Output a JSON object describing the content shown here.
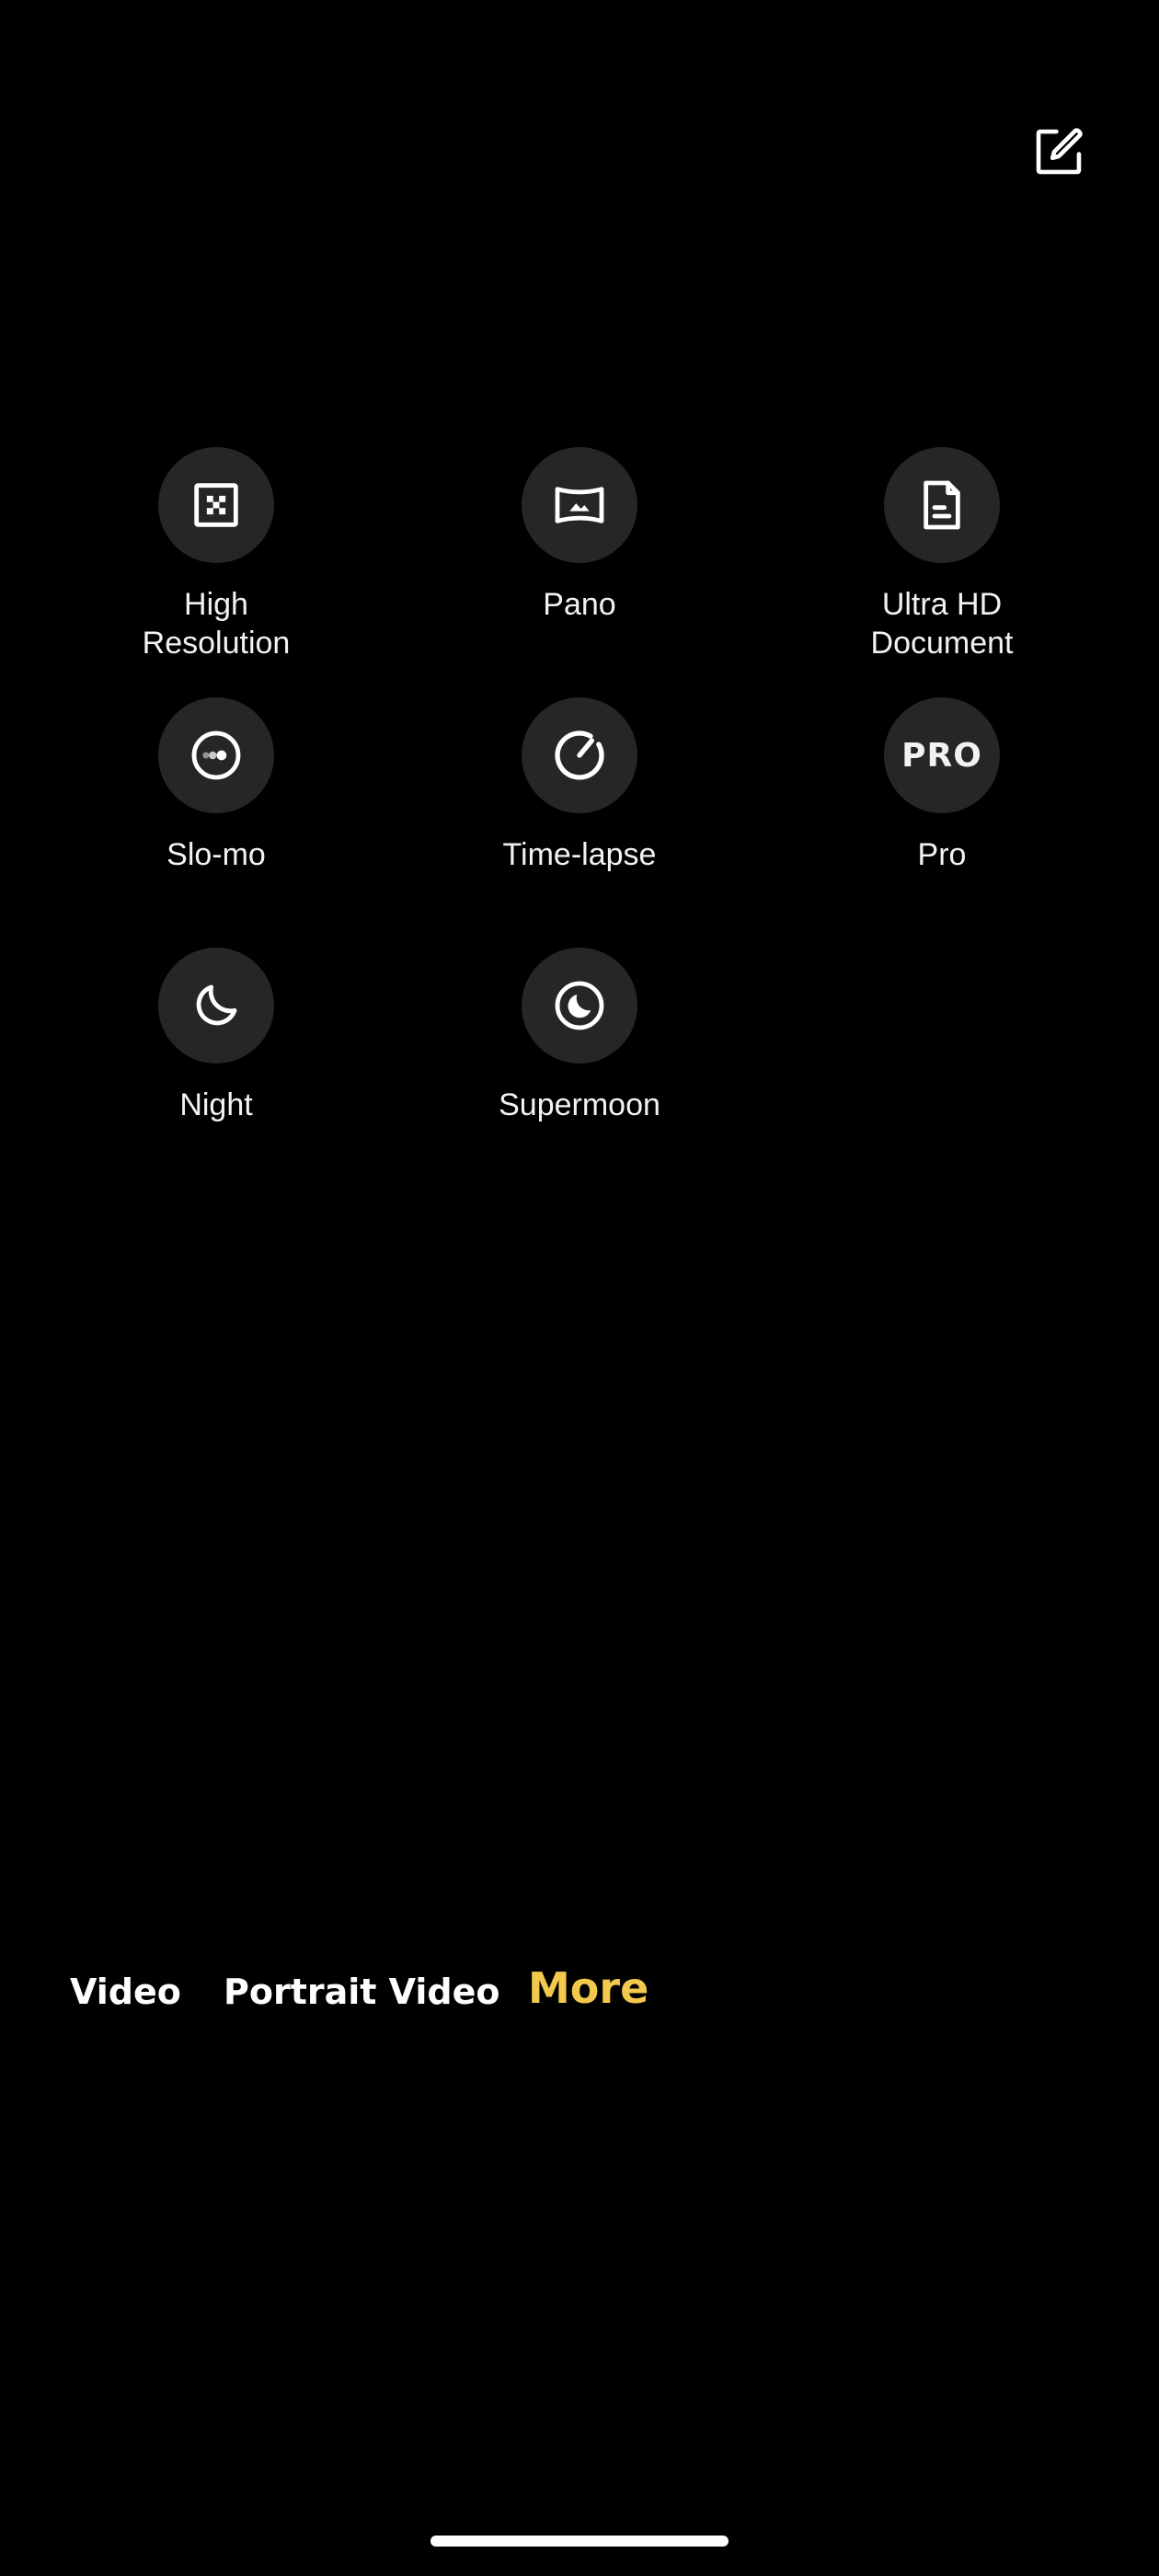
{
  "header": {
    "edit_icon": "edit-square-icon"
  },
  "modes": [
    {
      "label": "High\nResolution",
      "icon": "high-resolution-icon"
    },
    {
      "label": "Pano",
      "icon": "panorama-icon"
    },
    {
      "label": "Ultra HD\nDocument",
      "icon": "document-icon"
    },
    {
      "label": "Slo-mo",
      "icon": "slow-motion-icon"
    },
    {
      "label": "Time-lapse",
      "icon": "timelapse-icon"
    },
    {
      "label": "Pro",
      "icon_text": "PRO",
      "icon": "pro-icon"
    },
    {
      "label": "Night",
      "icon": "night-moon-icon"
    },
    {
      "label": "Supermoon",
      "icon": "supermoon-icon"
    }
  ],
  "tabs": [
    {
      "label": "Video",
      "active": false
    },
    {
      "label": "Portrait Video",
      "active": false
    },
    {
      "label": "More",
      "active": true
    }
  ],
  "colors": {
    "background": "#000000",
    "icon_circle": "#262626",
    "accent": "#F2C94C",
    "text": "#FFFFFF"
  }
}
